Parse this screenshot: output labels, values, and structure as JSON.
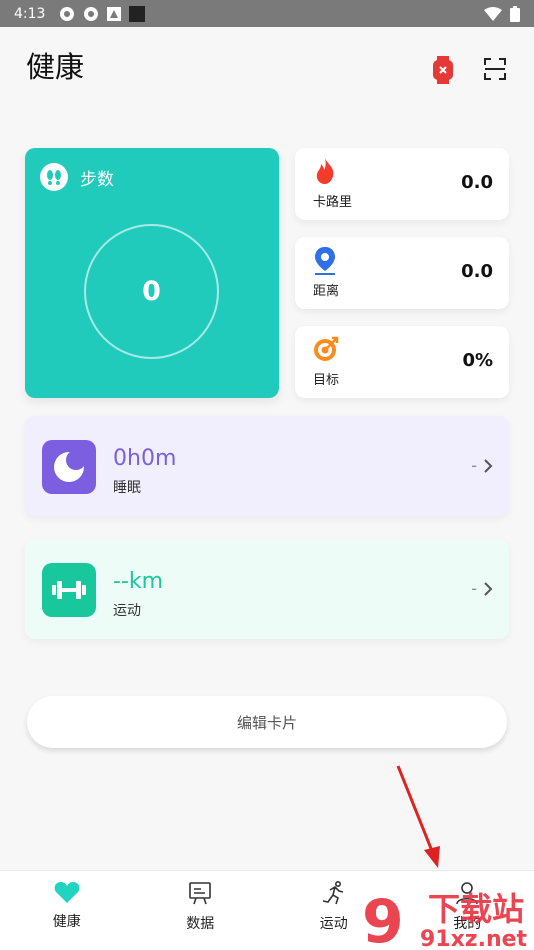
{
  "status_bar": {
    "time": "4:13"
  },
  "header": {
    "title": "健康"
  },
  "steps": {
    "label": "步数",
    "value": "0"
  },
  "stats": [
    {
      "label": "卡路里",
      "value": "0.0",
      "icon": "flame-icon",
      "color": "#f53b2b"
    },
    {
      "label": "距离",
      "value": "0.0",
      "icon": "location-pin-icon",
      "color": "#2f6fe8"
    },
    {
      "label": "目标",
      "value": "0%",
      "icon": "target-icon",
      "color": "#ff8a1d"
    }
  ],
  "sleep": {
    "value": "0h0m",
    "label": "睡眠",
    "trail": "-",
    "color": "#7b5fe0",
    "bg": "#f1eefd"
  },
  "exercise": {
    "value": "--km",
    "label": "运动",
    "trail": "-",
    "color": "#19c79d",
    "bg": "#eefcf8"
  },
  "edit_button": {
    "label": "编辑卡片"
  },
  "nav": [
    {
      "label": "健康",
      "icon": "heart-icon"
    },
    {
      "label": "数据",
      "icon": "chart-board-icon"
    },
    {
      "label": "运动",
      "icon": "runner-icon"
    },
    {
      "label": "我的",
      "icon": "user-icon"
    }
  ],
  "watermark": {
    "text": "下载站",
    "url": "91xz.net",
    "brand": "9"
  }
}
